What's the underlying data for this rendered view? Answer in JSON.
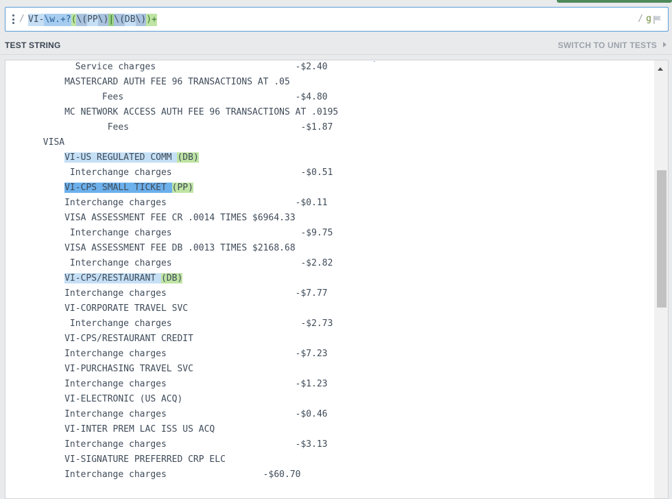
{
  "regex": {
    "delimiter_open": "/",
    "pattern_tokens": [
      {
        "text": "VI-",
        "kind": "lit"
      },
      {
        "text": "\\w.+?",
        "kind": "esc"
      },
      {
        "text": "(",
        "kind": "grp"
      },
      {
        "text": "\\(",
        "kind": "grp-esc"
      },
      {
        "text": "PP",
        "kind": "lit"
      },
      {
        "text": "\\)",
        "kind": "grp-esc"
      },
      {
        "text": "|",
        "kind": "alt"
      },
      {
        "text": "\\(",
        "kind": "grp-esc"
      },
      {
        "text": "DB",
        "kind": "lit"
      },
      {
        "text": "\\)",
        "kind": "grp-esc"
      },
      {
        "text": ")+",
        "kind": "grp"
      }
    ],
    "delimiter_close": "/",
    "flags": "g"
  },
  "test_string": {
    "title": "TEST STRING",
    "switch_label": "SWITCH TO UNIT TESTS",
    "lines": [
      [
        {
          "t": "             Service charges                          -$2.40"
        }
      ],
      [
        {
          "t": "           MASTERCARD AUTH FEE 96 TRANSACTIONS AT .05"
        }
      ],
      [
        {
          "t": "                  Fees                                -$4.80"
        }
      ],
      [
        {
          "t": "           MC NETWORK ACCESS AUTH FEE 96 TRANSACTIONS AT .0195"
        }
      ],
      [
        {
          "t": "                   Fees                                -$1.87"
        }
      ],
      [
        {
          "t": "       VISA"
        }
      ],
      [
        {
          "t": "           "
        },
        {
          "t": "VI-US REGULATED COMM ",
          "h": "a"
        },
        {
          "t": "(DB)",
          "h": "g"
        }
      ],
      [
        {
          "t": "            Interchange charges                        -$0.51"
        }
      ],
      [
        {
          "t": "           "
        },
        {
          "t": "VI-CPS SMALL TICKET ",
          "h": "b"
        },
        {
          "t": "(PP)",
          "h": "g"
        }
      ],
      [
        {
          "t": "           Interchange charges                        -$0.11"
        }
      ],
      [
        {
          "t": "           VISA ASSESSMENT FEE CR .0014 TIMES $6964.33"
        }
      ],
      [
        {
          "t": "            Interchange charges                        -$9.75"
        }
      ],
      [
        {
          "t": "           VISA ASSESSMENT FEE DB .0013 TIMES $2168.68"
        }
      ],
      [
        {
          "t": "            Interchange charges                        -$2.82"
        }
      ],
      [
        {
          "t": "           "
        },
        {
          "t": "VI-CPS/RESTAURANT ",
          "h": "a"
        },
        {
          "t": "(DB)",
          "h": "g"
        }
      ],
      [
        {
          "t": "           Interchange charges                        -$7.77"
        }
      ],
      [
        {
          "t": "           VI-CORPORATE TRAVEL SVC"
        }
      ],
      [
        {
          "t": "            Interchange charges                        -$2.73"
        }
      ],
      [
        {
          "t": "           VI-CPS/RESTAURANT CREDIT"
        }
      ],
      [
        {
          "t": "           Interchange charges                        -$7.23"
        }
      ],
      [
        {
          "t": "           VI-PURCHASING TRAVEL SVC"
        }
      ],
      [
        {
          "t": "           Interchange charges                        -$1.23"
        }
      ],
      [
        {
          "t": "           VI-ELECTRONIC (US ACQ)"
        }
      ],
      [
        {
          "t": "           Interchange charges                        -$0.46"
        }
      ],
      [
        {
          "t": "           VI-INTER PREM LAC ISS US ACQ"
        }
      ],
      [
        {
          "t": "           Interchange charges                        -$3.13"
        }
      ],
      [
        {
          "t": "           VI-SIGNATURE PREFERRED CRP ELC"
        }
      ],
      [
        {
          "t": "           Interchange charges                  -$60.70"
        }
      ]
    ]
  },
  "icons": {
    "drag": "drag-handle-icon",
    "flag": "flag-icon",
    "chevron": "chevron-right-icon"
  },
  "colors": {
    "accent": "#5b9bd5",
    "match_light": "#c5dff5",
    "match_active": "#6cb0ec",
    "group": "#bfe4a4"
  }
}
